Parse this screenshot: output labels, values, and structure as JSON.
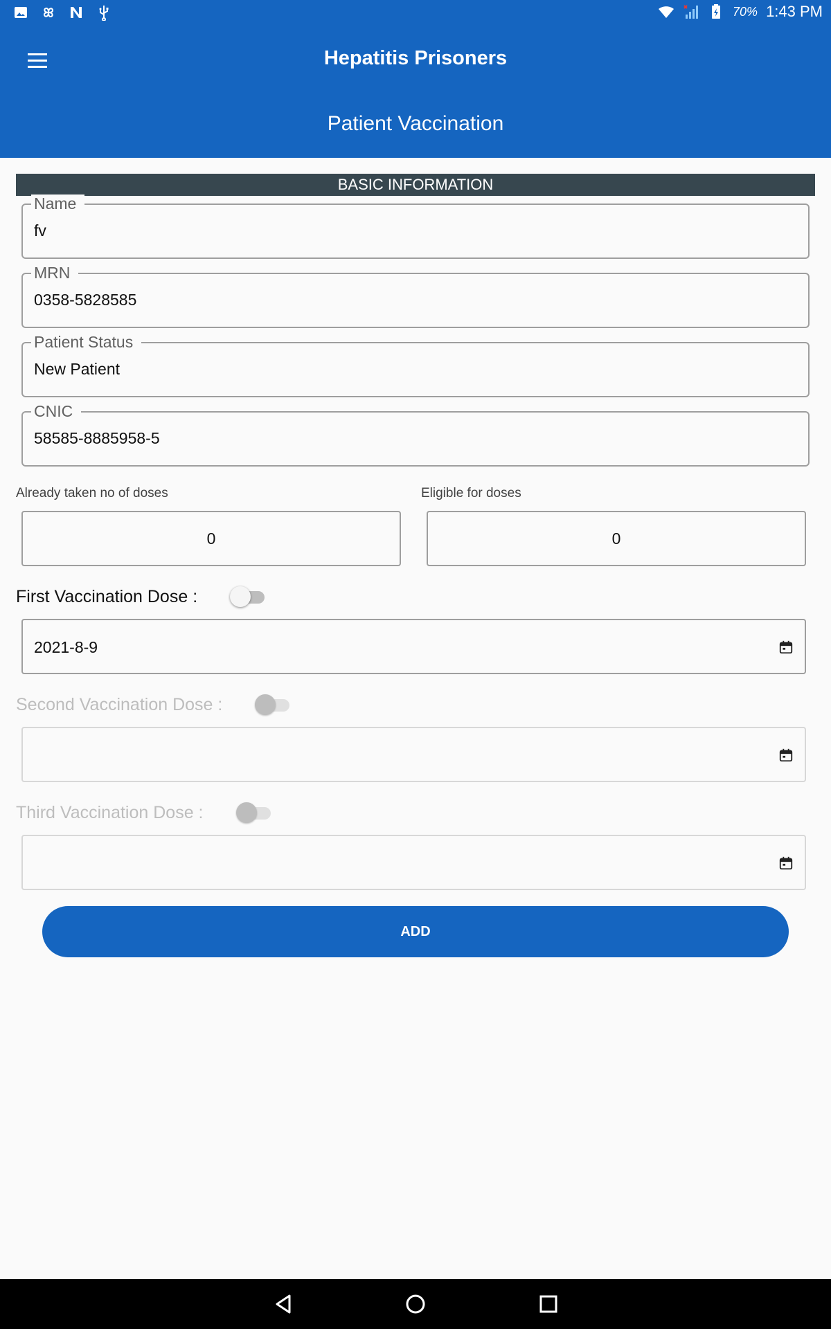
{
  "status_bar": {
    "battery": "70%",
    "time": "1:43 PM",
    "icons": [
      "image-icon",
      "pinwheel-icon",
      "n-icon",
      "usb-icon",
      "wifi-icon",
      "signal-icon",
      "battery-icon"
    ]
  },
  "app_bar": {
    "title": "Hepatitis Prisoners",
    "page_title": "Patient Vaccination"
  },
  "section": {
    "title": "BASIC INFORMATION"
  },
  "fields": {
    "name": {
      "label": "Name",
      "value": "fv"
    },
    "mrn": {
      "label": "MRN",
      "value": "0358-5828585"
    },
    "patient_status": {
      "label": "Patient Status",
      "value": "New Patient"
    },
    "cnic": {
      "label": "CNIC",
      "value": "58585-8885958-5"
    }
  },
  "doses": {
    "taken_label": "Already taken no of doses",
    "taken_value": "0",
    "eligible_label": "Eligible for doses",
    "eligible_value": "0"
  },
  "vaccination": {
    "first": {
      "label": "First Vaccination Dose :",
      "date": "2021-8-9",
      "enabled": true,
      "checked": false
    },
    "second": {
      "label": "Second Vaccination Dose :",
      "date": "",
      "enabled": false,
      "checked": false
    },
    "third": {
      "label": "Third Vaccination Dose :",
      "date": "",
      "enabled": false,
      "checked": false
    }
  },
  "actions": {
    "add_label": "ADD"
  },
  "colors": {
    "primary": "#1565c0",
    "section_header": "#37474f",
    "background": "#fafafa"
  }
}
